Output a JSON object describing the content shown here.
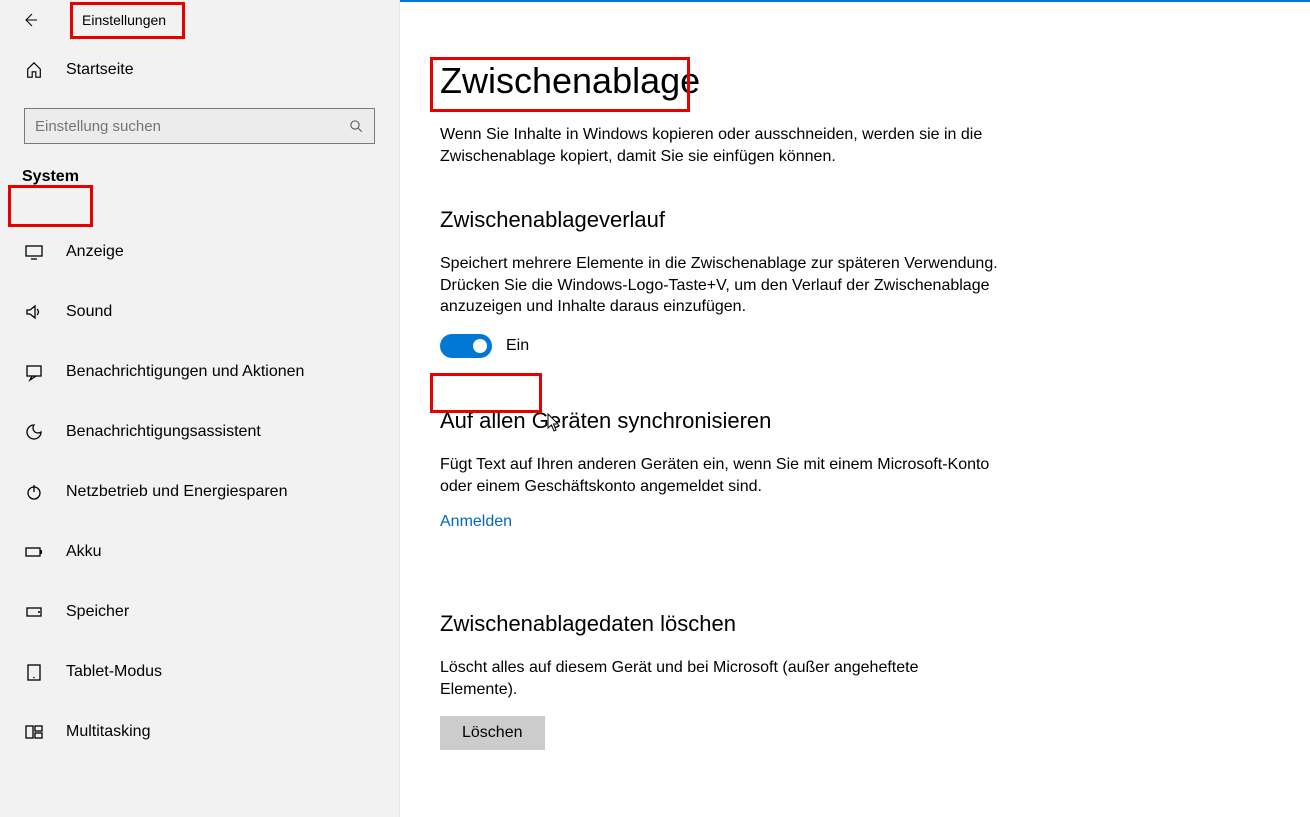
{
  "header": {
    "app_title": "Einstellungen",
    "home_label": "Startseite",
    "search_placeholder": "Einstellung suchen",
    "category_label": "System"
  },
  "sidebar": {
    "items": [
      {
        "label": "Anzeige"
      },
      {
        "label": "Sound"
      },
      {
        "label": "Benachrichtigungen und Aktionen"
      },
      {
        "label": "Benachrichtigungsassistent"
      },
      {
        "label": "Netzbetrieb und Energiesparen"
      },
      {
        "label": "Akku"
      },
      {
        "label": "Speicher"
      },
      {
        "label": "Tablet-Modus"
      },
      {
        "label": "Multitasking"
      }
    ],
    "icons": {
      "home": "home-icon",
      "display": "display-icon",
      "sound": "sound-icon",
      "notifications": "notifications-icon",
      "focus": "focus-assist-icon",
      "power": "power-icon",
      "battery": "battery-icon",
      "storage": "storage-icon",
      "tablet": "tablet-icon",
      "multitasking": "multitasking-icon"
    }
  },
  "main": {
    "title": "Zwischenablage",
    "intro": "Wenn Sie Inhalte in Windows kopieren oder ausschneiden, werden sie in die Zwischenablage kopiert, damit Sie sie einfügen können.",
    "section1": {
      "heading": "Zwischenablageverlauf",
      "desc": "Speichert mehrere Elemente in die Zwischenablage zur späteren Verwendung. Drücken Sie die Windows-Logo-Taste+V, um den Verlauf der Zwischenablage anzuzeigen und Inhalte daraus einzufügen.",
      "toggle_state": "Ein"
    },
    "section2": {
      "heading": "Auf allen Geräten synchronisieren",
      "desc": "Fügt Text auf Ihren anderen Geräten ein, wenn Sie mit einem Microsoft-Konto oder einem Geschäftskonto angemeldet sind.",
      "link": "Anmelden"
    },
    "section3": {
      "heading": "Zwischenablagedaten löschen",
      "desc": "Löscht alles auf diesem Gerät und bei Microsoft (außer angeheftete Elemente).",
      "button": "Löschen"
    }
  },
  "colors": {
    "accent": "#0078d4",
    "highlight": "#e60000"
  }
}
